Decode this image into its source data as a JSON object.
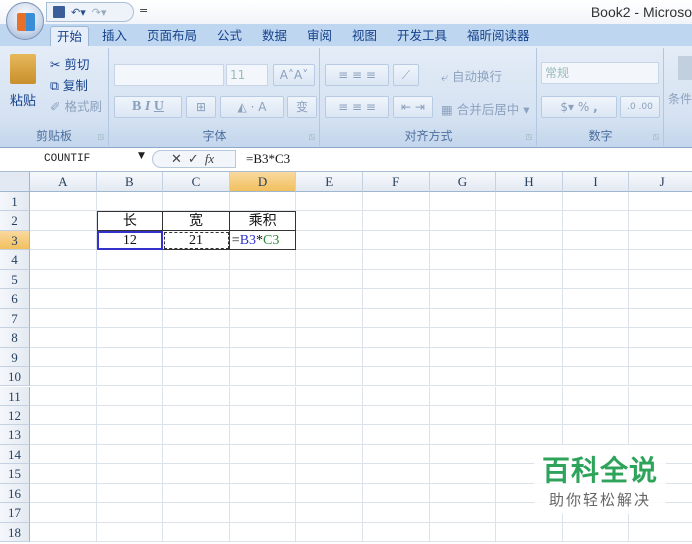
{
  "window": {
    "title": "Book2 - Microso"
  },
  "qat": {
    "more": "="
  },
  "tabs": [
    "开始",
    "插入",
    "页面布局",
    "公式",
    "数据",
    "审阅",
    "视图",
    "开发工具",
    "福昕阅读器"
  ],
  "ribbon": {
    "clipboard": {
      "label": "剪贴板",
      "paste": "粘贴",
      "cut": "剪切",
      "copy": "复制",
      "format_painter": "格式刷"
    },
    "font": {
      "label": "字体",
      "font_size": "11",
      "bold": "B",
      "italic": "I",
      "underline": "U"
    },
    "alignment": {
      "label": "对齐方式",
      "wrap_text": "自动换行",
      "merge_center": "合并后居中"
    },
    "number": {
      "label": "数字",
      "format": "常规",
      "percent": "%",
      "comma": ","
    },
    "styles": {
      "conditional": "条件"
    }
  },
  "formula_bar": {
    "name_box": "COUNTIF",
    "formula": "=B3*C3"
  },
  "sheet": {
    "columns": [
      "A",
      "B",
      "C",
      "D",
      "E",
      "F",
      "G",
      "H",
      "I",
      "J"
    ],
    "rows": [
      "1",
      "2",
      "3",
      "4",
      "5",
      "6",
      "7",
      "8",
      "9",
      "10",
      "11",
      "12",
      "13",
      "14",
      "15",
      "16",
      "17",
      "18"
    ],
    "selected_column": "D",
    "selected_row": "3",
    "cells": {
      "B2": "长",
      "C2": "宽",
      "D2": "乘积",
      "B3": "12",
      "C3": "21"
    },
    "editing_cell": {
      "ref": "D3",
      "parts": [
        "=",
        "B3",
        "*",
        "C3"
      ]
    }
  },
  "watermark": {
    "title": "百科全说",
    "subtitle": "助你轻松解决"
  }
}
